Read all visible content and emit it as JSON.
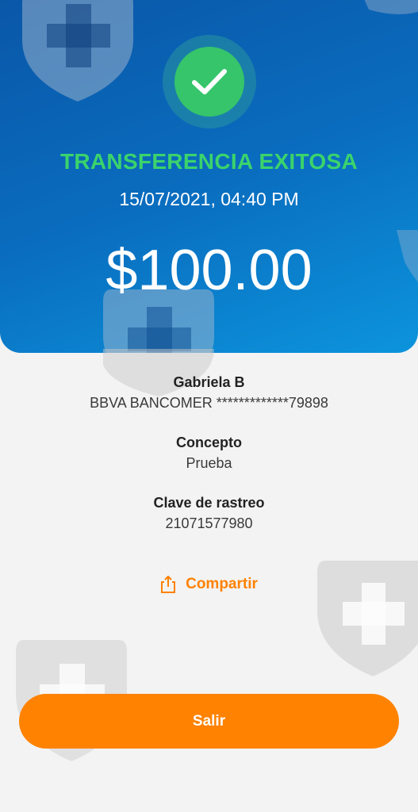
{
  "colors": {
    "success_green": "#36c56a",
    "status_text_green": "#3bd36c",
    "accent_orange": "#ff8200",
    "header_blue": "#0a6cbe"
  },
  "status": {
    "title": "TRANSFERENCIA EXITOSA",
    "datetime": "15/07/2021, 04:40 PM",
    "amount": "$100.00",
    "icon": "check-icon"
  },
  "recipient": {
    "name": "Gabriela B",
    "account": "BBVA BANCOMER *************79898"
  },
  "concept": {
    "label": "Concepto",
    "value": "Prueba"
  },
  "tracking": {
    "label": "Clave de rastreo",
    "value": "21071577980"
  },
  "actions": {
    "share_label": "Compartir",
    "share_icon": "share-icon",
    "exit_label": "Salir"
  },
  "watermark_icon": "shield-cross-icon"
}
